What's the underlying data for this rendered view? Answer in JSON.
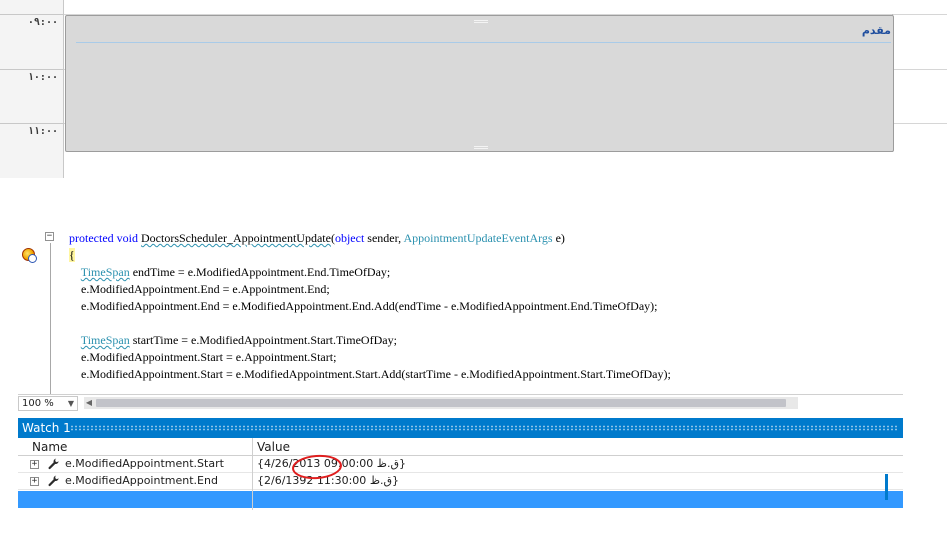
{
  "scheduler": {
    "time_slots": [
      "٠٩:٠٠",
      "١٠:٠٠",
      "١١:٠٠"
    ],
    "appointment": {
      "subject": "مقدم"
    }
  },
  "editor": {
    "lines": [
      [
        {
          "t": "protected",
          "c": "kw"
        },
        {
          "t": " "
        },
        {
          "t": "void",
          "c": "kw"
        },
        {
          "t": " "
        },
        {
          "t": "DoctorsScheduler_AppointmentUpdate",
          "c": "sq"
        },
        {
          "t": "("
        },
        {
          "t": "object",
          "c": "kw"
        },
        {
          "t": " sender, "
        },
        {
          "t": "AppointmentUpdateEventArgs",
          "c": "typ"
        },
        {
          "t": " e)"
        }
      ],
      [
        {
          "t": "{",
          "c": "brace-hl"
        }
      ],
      [
        {
          "t": "    "
        },
        {
          "t": "TimeSpan",
          "c": "typ sq"
        },
        {
          "t": " endTime = e.ModifiedAppointment.End.TimeOfDay;"
        }
      ],
      [
        {
          "t": "    e.ModifiedAppointment.End = e.Appointment.End;"
        }
      ],
      [
        {
          "t": "    e.ModifiedAppointment.End = e.ModifiedAppointment.End.Add(endTime - e.ModifiedAppointment.End.TimeOfDay);"
        }
      ],
      [
        {
          "t": ""
        }
      ],
      [
        {
          "t": "    "
        },
        {
          "t": "TimeSpan",
          "c": "typ sq"
        },
        {
          "t": " startTime = e.ModifiedAppointment.Start.TimeOfDay;"
        }
      ],
      [
        {
          "t": "    e.ModifiedAppointment.Start = e.Appointment.Start;"
        }
      ],
      [
        {
          "t": "    e.ModifiedAppointment.Start = e.ModifiedAppointment.Start.Add(startTime - e.ModifiedAppointment.Start.TimeOfDay);"
        }
      ]
    ],
    "zoom": "100 %"
  },
  "watch": {
    "title": "Watch 1",
    "columns": {
      "name": "Name",
      "value": "Value"
    },
    "rows": [
      {
        "name": "e.ModifiedAppointment.Start",
        "value": "{4/26/2013 09:00:00 ق.ظ}"
      },
      {
        "name": "e.ModifiedAppointment.End",
        "value": "{2/6/1392 11:30:00 ق.ظ}"
      }
    ]
  },
  "icons": {
    "breakpoint": "breakpoint-icon",
    "wrench": "wrench-icon",
    "expander": "expand-plus-icon"
  },
  "colors": {
    "accent": "#007acc",
    "selection": "#3399ff",
    "keyword": "#0000ff",
    "type": "#2b91af",
    "annotation": "#e01e1e"
  }
}
